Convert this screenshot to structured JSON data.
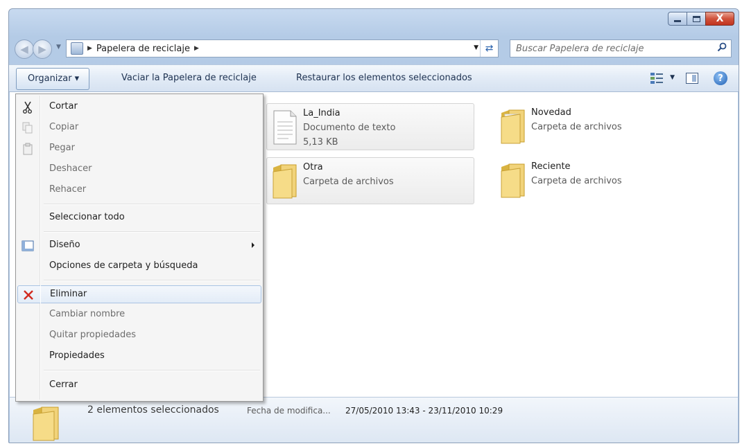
{
  "window": {
    "controls": [
      "minimize-icon",
      "maximize-icon",
      "close-icon"
    ],
    "close_glyph": "X"
  },
  "address": {
    "location": "Papelera de reciclaje",
    "search_placeholder": "Buscar Papelera de reciclaje"
  },
  "toolbar": {
    "organize": "Organizar ▾",
    "empty_bin": "Vaciar la Papelera de reciclaje",
    "restore_selected": "Restaurar los elementos seleccionados",
    "help_glyph": "?"
  },
  "items": [
    {
      "name": "La_India",
      "type": "Documento de texto",
      "size": "5,13 KB",
      "icon": "text-file-icon",
      "selected": true
    },
    {
      "name": "Novedad",
      "type": "Carpeta de archivos",
      "icon": "folder-icon",
      "selected": false
    },
    {
      "name": "Otra",
      "type": "Carpeta de archivos",
      "icon": "folder-icon",
      "selected": true
    },
    {
      "name": "Reciente",
      "type": "Carpeta de archivos",
      "icon": "folder-icon",
      "selected": false
    }
  ],
  "details": {
    "count_text": "2 elementos seleccionados",
    "date_label": "Fecha de modifica...",
    "date_value": "27/05/2010 13:43 - 23/11/2010 10:29"
  },
  "menu": {
    "items": [
      {
        "label": "Cortar",
        "icon": "scissors-icon",
        "enabled": true
      },
      {
        "label": "Copiar",
        "icon": "copy-icon",
        "enabled": false
      },
      {
        "label": "Pegar",
        "icon": "paste-icon",
        "enabled": false
      },
      {
        "label": "Deshacer",
        "enabled": false
      },
      {
        "label": "Rehacer",
        "enabled": false
      },
      {
        "label": "Seleccionar todo",
        "enabled": true
      },
      {
        "label": "Diseño",
        "icon": "layout-icon",
        "enabled": true,
        "submenu": true
      },
      {
        "label": "Opciones de carpeta y búsqueda",
        "enabled": true
      },
      {
        "label": "Eliminar",
        "icon": "delete-x-icon",
        "enabled": true,
        "highlighted": true
      },
      {
        "label": "Cambiar nombre",
        "enabled": false
      },
      {
        "label": "Quitar propiedades",
        "enabled": false
      },
      {
        "label": "Propiedades",
        "enabled": true
      },
      {
        "label": "Cerrar",
        "enabled": true
      }
    ]
  }
}
